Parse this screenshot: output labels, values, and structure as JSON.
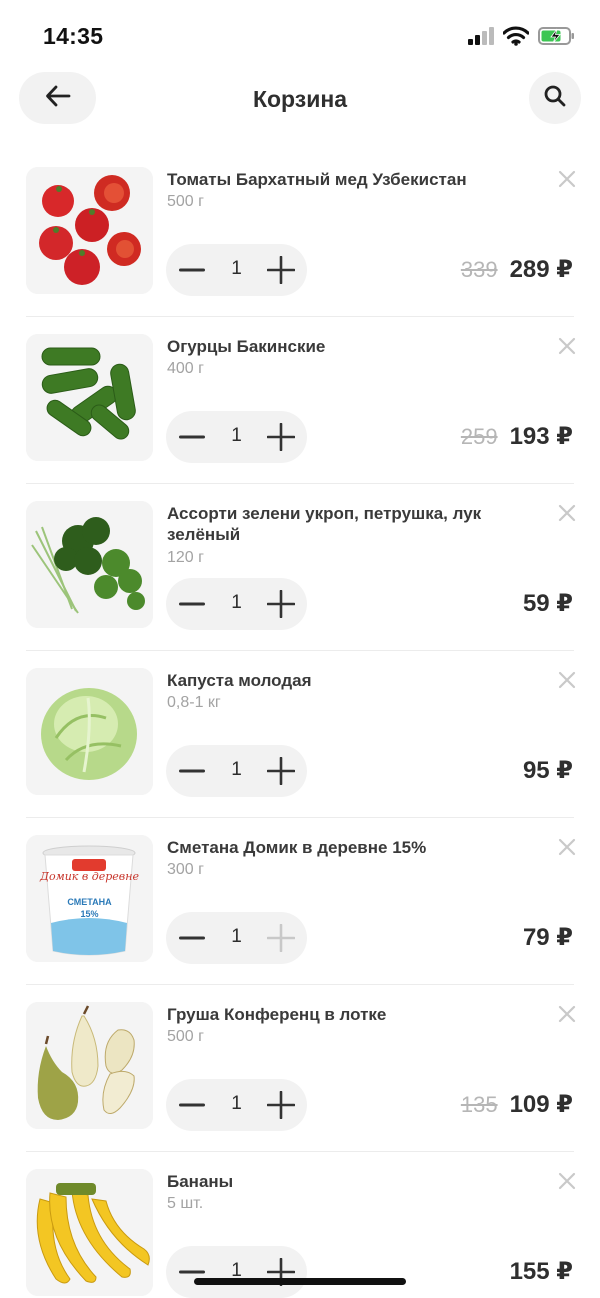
{
  "status_bar": {
    "time": "14:35"
  },
  "header": {
    "title": "Корзина"
  },
  "cart": {
    "items": [
      {
        "name": "Томаты Бархатный мед Узбекистан",
        "weight": "500 г",
        "qty": "1",
        "old_price": "339",
        "price": "289 ₽",
        "plus_enabled": true
      },
      {
        "name": "Огурцы Бакинские",
        "weight": "400 г",
        "qty": "1",
        "old_price": "259",
        "price": "193 ₽",
        "plus_enabled": true
      },
      {
        "name": "Ассорти зелени укроп, петрушка, лук зелёный",
        "weight": "120 г",
        "qty": "1",
        "old_price": "",
        "price": "59 ₽",
        "plus_enabled": true
      },
      {
        "name": "Капуста молодая",
        "weight": "0,8-1 кг",
        "qty": "1",
        "old_price": "",
        "price": "95 ₽",
        "plus_enabled": true
      },
      {
        "name": "Сметана Домик в деревне 15%",
        "weight": "300 г",
        "qty": "1",
        "old_price": "",
        "price": "79 ₽",
        "plus_enabled": false
      },
      {
        "name": "Груша Конференц в лотке",
        "weight": "500 г",
        "qty": "1",
        "old_price": "135",
        "price": "109 ₽",
        "plus_enabled": true
      },
      {
        "name": "Бананы",
        "weight": "5 шт.",
        "qty": "1",
        "old_price": "",
        "price": "155 ₽",
        "plus_enabled": true
      }
    ]
  },
  "product_images": {
    "sour_cream_label": {
      "brand": "Домик в деревне",
      "product": "СМЕТАНА",
      "fat": "15%"
    }
  },
  "colors": {
    "accent_text": "#2f2f2f",
    "muted": "#a3a3a3",
    "button_bg": "#f2f2f2",
    "strike": "#b6b6b6"
  }
}
